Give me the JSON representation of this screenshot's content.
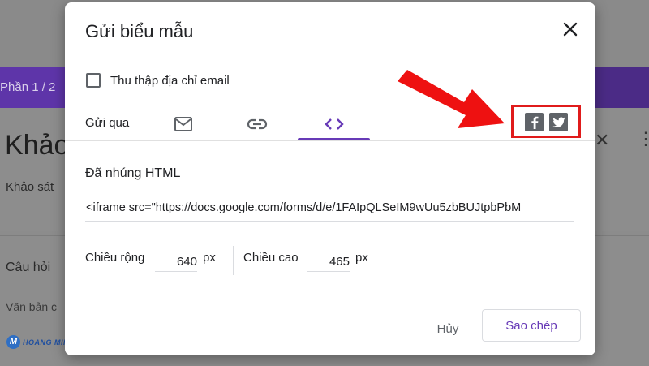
{
  "background": {
    "top_text": "...",
    "part_label": "Phần 1 / 2",
    "form_title": "Khảo",
    "form_subtitle": "Khảo sát",
    "question_label": "Câu hỏi",
    "answer_hint": "Văn bản c",
    "logo_text": "HOANG MINH"
  },
  "dialog": {
    "title": "Gửi biểu mẫu",
    "collect_email_label": "Thu thập địa chỉ email",
    "collect_email_checked": false,
    "send_via_label": "Gửi qua",
    "tabs": [
      {
        "name": "email",
        "icon": "mail-icon",
        "active": false
      },
      {
        "name": "link",
        "icon": "link-icon",
        "active": false
      },
      {
        "name": "embed",
        "icon": "code-icon",
        "active": true
      }
    ],
    "social": [
      {
        "name": "facebook",
        "icon": "facebook-icon"
      },
      {
        "name": "twitter",
        "icon": "twitter-icon"
      }
    ],
    "embed_section_title": "Đã nhúng HTML",
    "embed_code": "<iframe src=\"https://docs.google.com/forms/d/e/1FAIpQLSeIM9wUu5zbBUJtpbPbM",
    "width_label": "Chiều rộng",
    "width_value": "640",
    "height_label": "Chiều cao",
    "height_value": "465",
    "unit": "px",
    "cancel_label": "Hủy",
    "copy_label": "Sao chép"
  },
  "colors": {
    "accent": "#673ab7",
    "annotation_red": "#e01b1b"
  }
}
